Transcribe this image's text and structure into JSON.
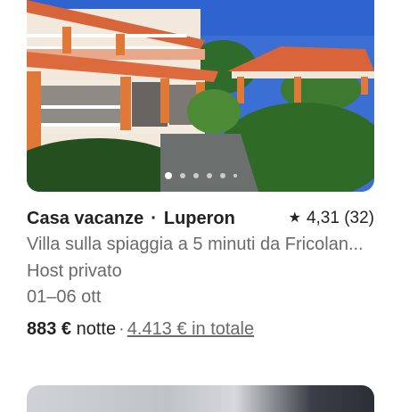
{
  "listing": {
    "type": "Casa vacanze",
    "separator": "·",
    "location": "Luperon",
    "rating": "4,31 (32)",
    "description": "Villa sulla spiaggia a 5 minuti da Fricolan...",
    "host": "Host privato",
    "dates": "01–06 ott",
    "price": "883 €",
    "price_unit": "notte",
    "price_separator": "·",
    "total": "4.413 € in totale",
    "icons": {
      "rating": "star-icon"
    },
    "colors": {
      "text": "#222222",
      "secondary": "#6a6a6a",
      "sky": "#3a6fd6",
      "roof": "#e06a3a"
    }
  },
  "carousel": {
    "count": 6,
    "active_index": 0
  }
}
